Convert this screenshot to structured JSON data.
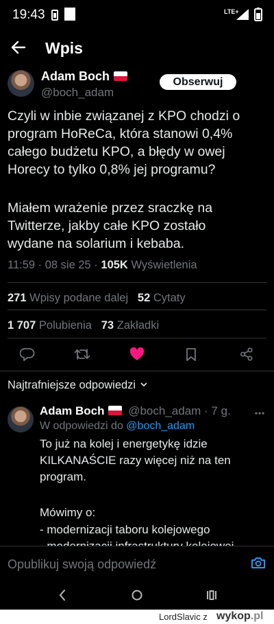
{
  "status_bar": {
    "time": "19:43",
    "network": "LTE+"
  },
  "header": {
    "title": "Wpis"
  },
  "tweet": {
    "author_name": "Adam Boch",
    "author_handle": "@boch_adam",
    "follow_label": "Obserwuj",
    "paragraphs": [
      [
        "Czyli w inbie związanej z KPO chodzi o",
        "program HoReCa, która stanowi 0,4%",
        "całego budżetu KPO, a błędy w owej",
        "Horecy to tylko 0,8% jej programu?"
      ],
      [
        "Miałem wrażenie przez sraczkę na",
        "Twitterze, jakby całe KPO zostało",
        "wydane na solarium i kebaba."
      ]
    ],
    "time": "11:59",
    "date": "08 sie 25",
    "views_count": "105K",
    "views_label": "Wyświetlenia",
    "reposts_count": "271",
    "reposts_label": "Wpisy podane dalej",
    "quotes_count": "52",
    "quotes_label": "Cytaty",
    "likes_count": "1 707",
    "likes_label": "Polubienia",
    "bookmarks_count": "73",
    "bookmarks_label": "Zakładki"
  },
  "actions": [
    "reply-icon",
    "retweet-icon",
    "like-icon",
    "bookmark-icon",
    "share-icon"
  ],
  "replies": {
    "sort_label": "Najtrafniejsze odpowiedzi",
    "first": {
      "author_name": "Adam Boch",
      "author_handle": "@boch_adam",
      "age": "· 7 g.",
      "context_prefix": "W odpowiedzi do",
      "context_handle": "@boch_adam",
      "lines": [
        "To już na kolej i energetykę idzie",
        "KILKANAŚCIE razy więcej niż na ten",
        "program.",
        "",
        "Mówimy o:",
        "- modernizacji taboru kolejowego",
        "- modernizacji infrastruktury kolejowej"
      ]
    }
  },
  "composer": {
    "placeholder": "Opublikuj swoją odpowiedź"
  },
  "watermark": {
    "user": "LordSlavic",
    "via": "z",
    "site": "wykop",
    "tld": ".pl"
  },
  "colors": {
    "accent": "#1d9bf0",
    "like": "#f91880",
    "background": "#000000",
    "secondary_text": "#71767b"
  }
}
